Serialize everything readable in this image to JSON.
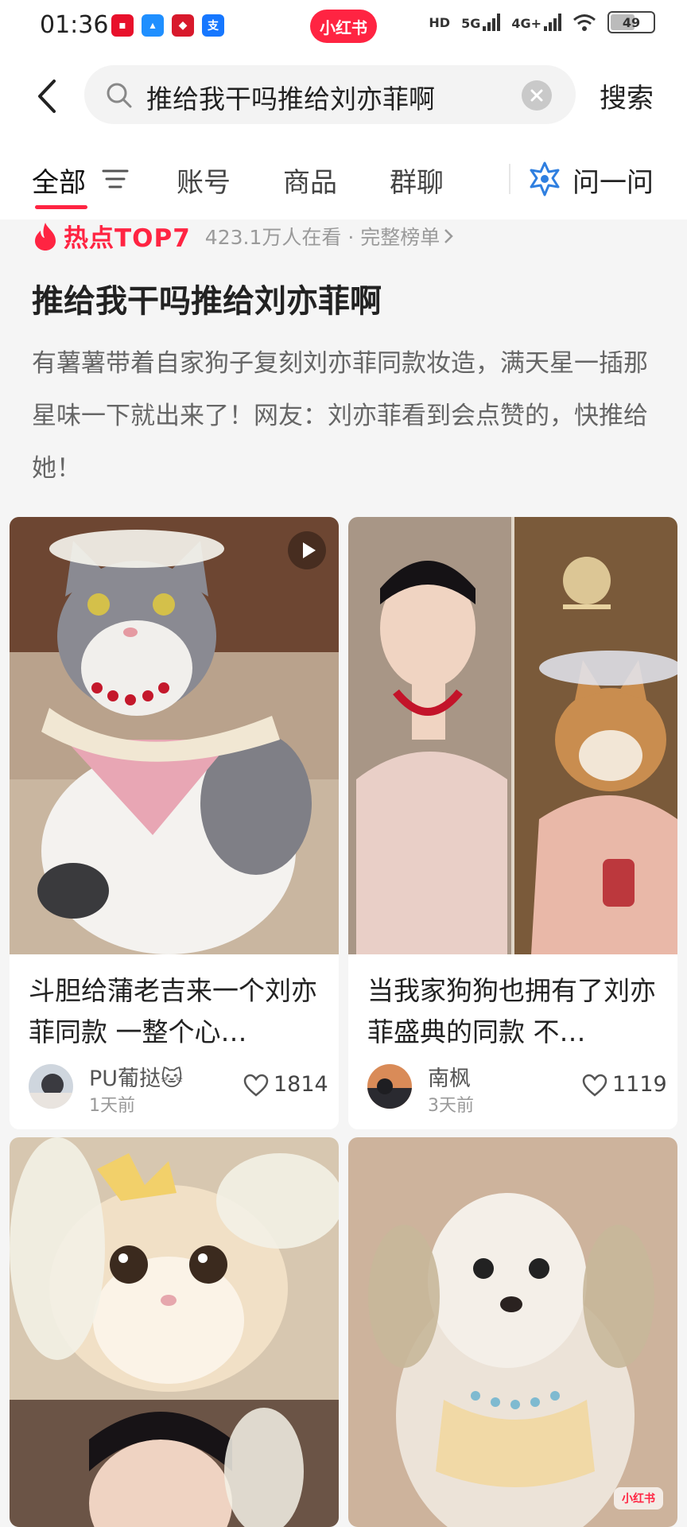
{
  "colors": {
    "accent": "#ff2442",
    "background": "#f5f5f5"
  },
  "status_bar": {
    "time": "01:36",
    "app_badge": "小红书",
    "hd": "HD",
    "net1": "5G",
    "net2": "4G+",
    "battery": "49"
  },
  "search": {
    "query": "推给我干吗推给刘亦菲啊",
    "button_label": "搜索"
  },
  "tabs": [
    {
      "label": "全部"
    },
    {
      "label": "账号"
    },
    {
      "label": "商品"
    },
    {
      "label": "群聊"
    }
  ],
  "ask": {
    "label": "问一问"
  },
  "hot": {
    "label": "热点TOP7",
    "meta": "423.1万人在看 · 完整榜单",
    "title": "推给我干吗推给刘亦菲啊",
    "description": "有薯薯带着自家狗子复刻刘亦菲同款妆造，满天星一插那星味一下就出来了！网友：刘亦菲看到会点赞的，快推给她！"
  },
  "cards": [
    {
      "title": "斗胆给蒲老吉来一个刘亦菲同款 一整个心…",
      "author": "PU葡挞🐱",
      "posted": "1天前",
      "likes": "1814"
    },
    {
      "title": "当我家狗狗也拥有了刘亦菲盛典的同款 不…",
      "author": "南枫",
      "posted": "3天前",
      "likes": "1119"
    }
  ],
  "watermark": "小红书"
}
